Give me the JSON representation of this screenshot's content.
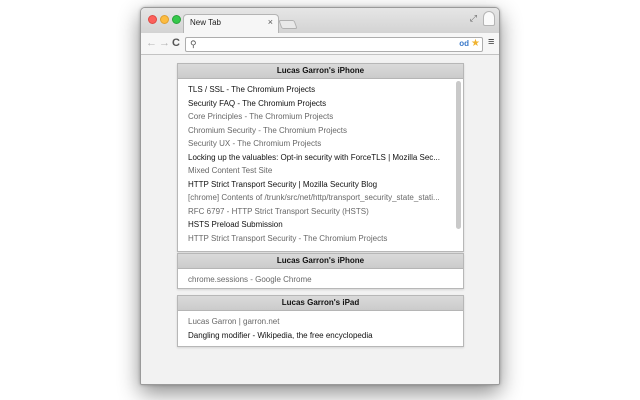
{
  "browser": {
    "tab_title": "New Tab",
    "tab_close": "×",
    "fullscreen_glyph": "⤢",
    "nav": {
      "back": "←",
      "forward": "→",
      "reload": "C"
    },
    "omnibox": {
      "value": "",
      "placeholder": "",
      "search_glyph": "⚲",
      "ext_text": "od",
      "star": "★"
    },
    "menu_glyph": "≡"
  },
  "devices": [
    {
      "name": "Lucas Garron's iPhone",
      "items": [
        {
          "title": "TLS / SSL - The Chromium Projects",
          "visited": false
        },
        {
          "title": "Security FAQ - The Chromium Projects",
          "visited": false
        },
        {
          "title": "Core Principles - The Chromium Projects",
          "visited": true
        },
        {
          "title": "Chromium Security - The Chromium Projects",
          "visited": true
        },
        {
          "title": "Security UX - The Chromium Projects",
          "visited": true
        },
        {
          "title": "Locking up the valuables: Opt-in security with ForceTLS | Mozilla Sec...",
          "visited": false
        },
        {
          "title": "Mixed Content Test Site",
          "visited": true
        },
        {
          "title": "HTTP Strict Transport Security | Mozilla Security Blog",
          "visited": false
        },
        {
          "title": "[chrome] Contents of /trunk/src/net/http/transport_security_state_stati...",
          "visited": true
        },
        {
          "title": "RFC 6797 - HTTP Strict Transport Security (HSTS)",
          "visited": true
        },
        {
          "title": "HSTS Preload Submission",
          "visited": false
        },
        {
          "title": "HTTP Strict Transport Security - The Chromium Projects",
          "visited": true
        }
      ]
    },
    {
      "name": "Lucas Garron's iPhone",
      "items": [
        {
          "title": "chrome.sessions - Google Chrome",
          "visited": true
        }
      ]
    },
    {
      "name": "Lucas Garron's iPad",
      "items": [
        {
          "title": "Lucas Garron | garron.net",
          "visited": true
        },
        {
          "title": "Dangling modifier - Wikipedia, the free encyclopedia",
          "visited": false
        }
      ]
    }
  ]
}
